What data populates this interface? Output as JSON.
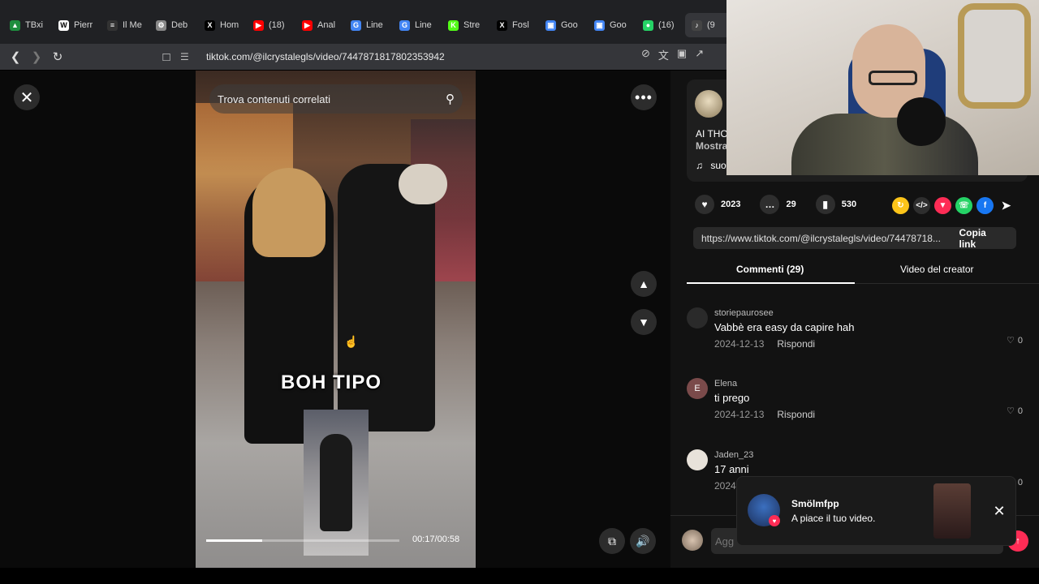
{
  "browser": {
    "tabs": [
      {
        "label": "TBxi",
        "color": "#1e8e3e",
        "glyph": "▲"
      },
      {
        "label": "Pierr",
        "color": "#ffffff",
        "glyph": "W"
      },
      {
        "label": "Il Me",
        "color": "#333333",
        "glyph": "≡"
      },
      {
        "label": "Deb",
        "color": "#888888",
        "glyph": "⚙"
      },
      {
        "label": "Hom",
        "color": "#000000",
        "glyph": "X"
      },
      {
        "label": "(18)",
        "color": "#ff0000",
        "glyph": "▶"
      },
      {
        "label": "Anal",
        "color": "#ff0000",
        "glyph": "▶"
      },
      {
        "label": "Line",
        "color": "#4285f4",
        "glyph": "G"
      },
      {
        "label": "Line",
        "color": "#4285f4",
        "glyph": "G"
      },
      {
        "label": "Stre",
        "color": "#53fc18",
        "glyph": "K"
      },
      {
        "label": "Fosl",
        "color": "#000000",
        "glyph": "X"
      },
      {
        "label": "Goo",
        "color": "#4285f4",
        "glyph": "▣"
      },
      {
        "label": "Goo",
        "color": "#4285f4",
        "glyph": "▣"
      },
      {
        "label": "(16)",
        "color": "#25d366",
        "glyph": "●"
      },
      {
        "label": "(9",
        "color": "#444444",
        "glyph": "♪"
      }
    ],
    "url": "tiktok.com/@ilcrystalegls/video/7447871817802353942"
  },
  "video": {
    "search_placeholder": "Trova contenuti correlati",
    "caption": "BOH TIPO",
    "time": "00:17/00:58",
    "progress": 0.29
  },
  "author": {
    "desc_line1": "AI THO",
    "desc_more": "Mostra",
    "music": "suo"
  },
  "actions": {
    "likes": "2023",
    "comments": "29",
    "saves": "530"
  },
  "share_colors": [
    "#fcc419",
    "#2e2e2e",
    "#fe2c55",
    "#25d366",
    "#1877f2"
  ],
  "link": {
    "url": "https://www.tiktok.com/@ilcrystalegls/video/74478718...",
    "copy_label": "Copia link"
  },
  "panel_tabs": {
    "comments": "Commenti (29)",
    "creator_videos": "Video del creator"
  },
  "comments": [
    {
      "user": "storiepaurosee",
      "text": "Vabbè era easy da capire hah",
      "date": "2024-12-13",
      "reply": "Rispondi",
      "likes": "0",
      "avatar": ""
    },
    {
      "user": "Elena",
      "text": "ti prego",
      "date": "2024-12-13",
      "reply": "Rispondi",
      "likes": "0",
      "avatar": "E"
    },
    {
      "user": "Jaden_23",
      "text": "17 anni",
      "date": "2024",
      "reply": "",
      "likes": "0",
      "avatar": ""
    }
  ],
  "toast": {
    "name": "Smölmfpp",
    "message": "A piace il tuo video."
  },
  "compose": {
    "placeholder": "Agg"
  }
}
